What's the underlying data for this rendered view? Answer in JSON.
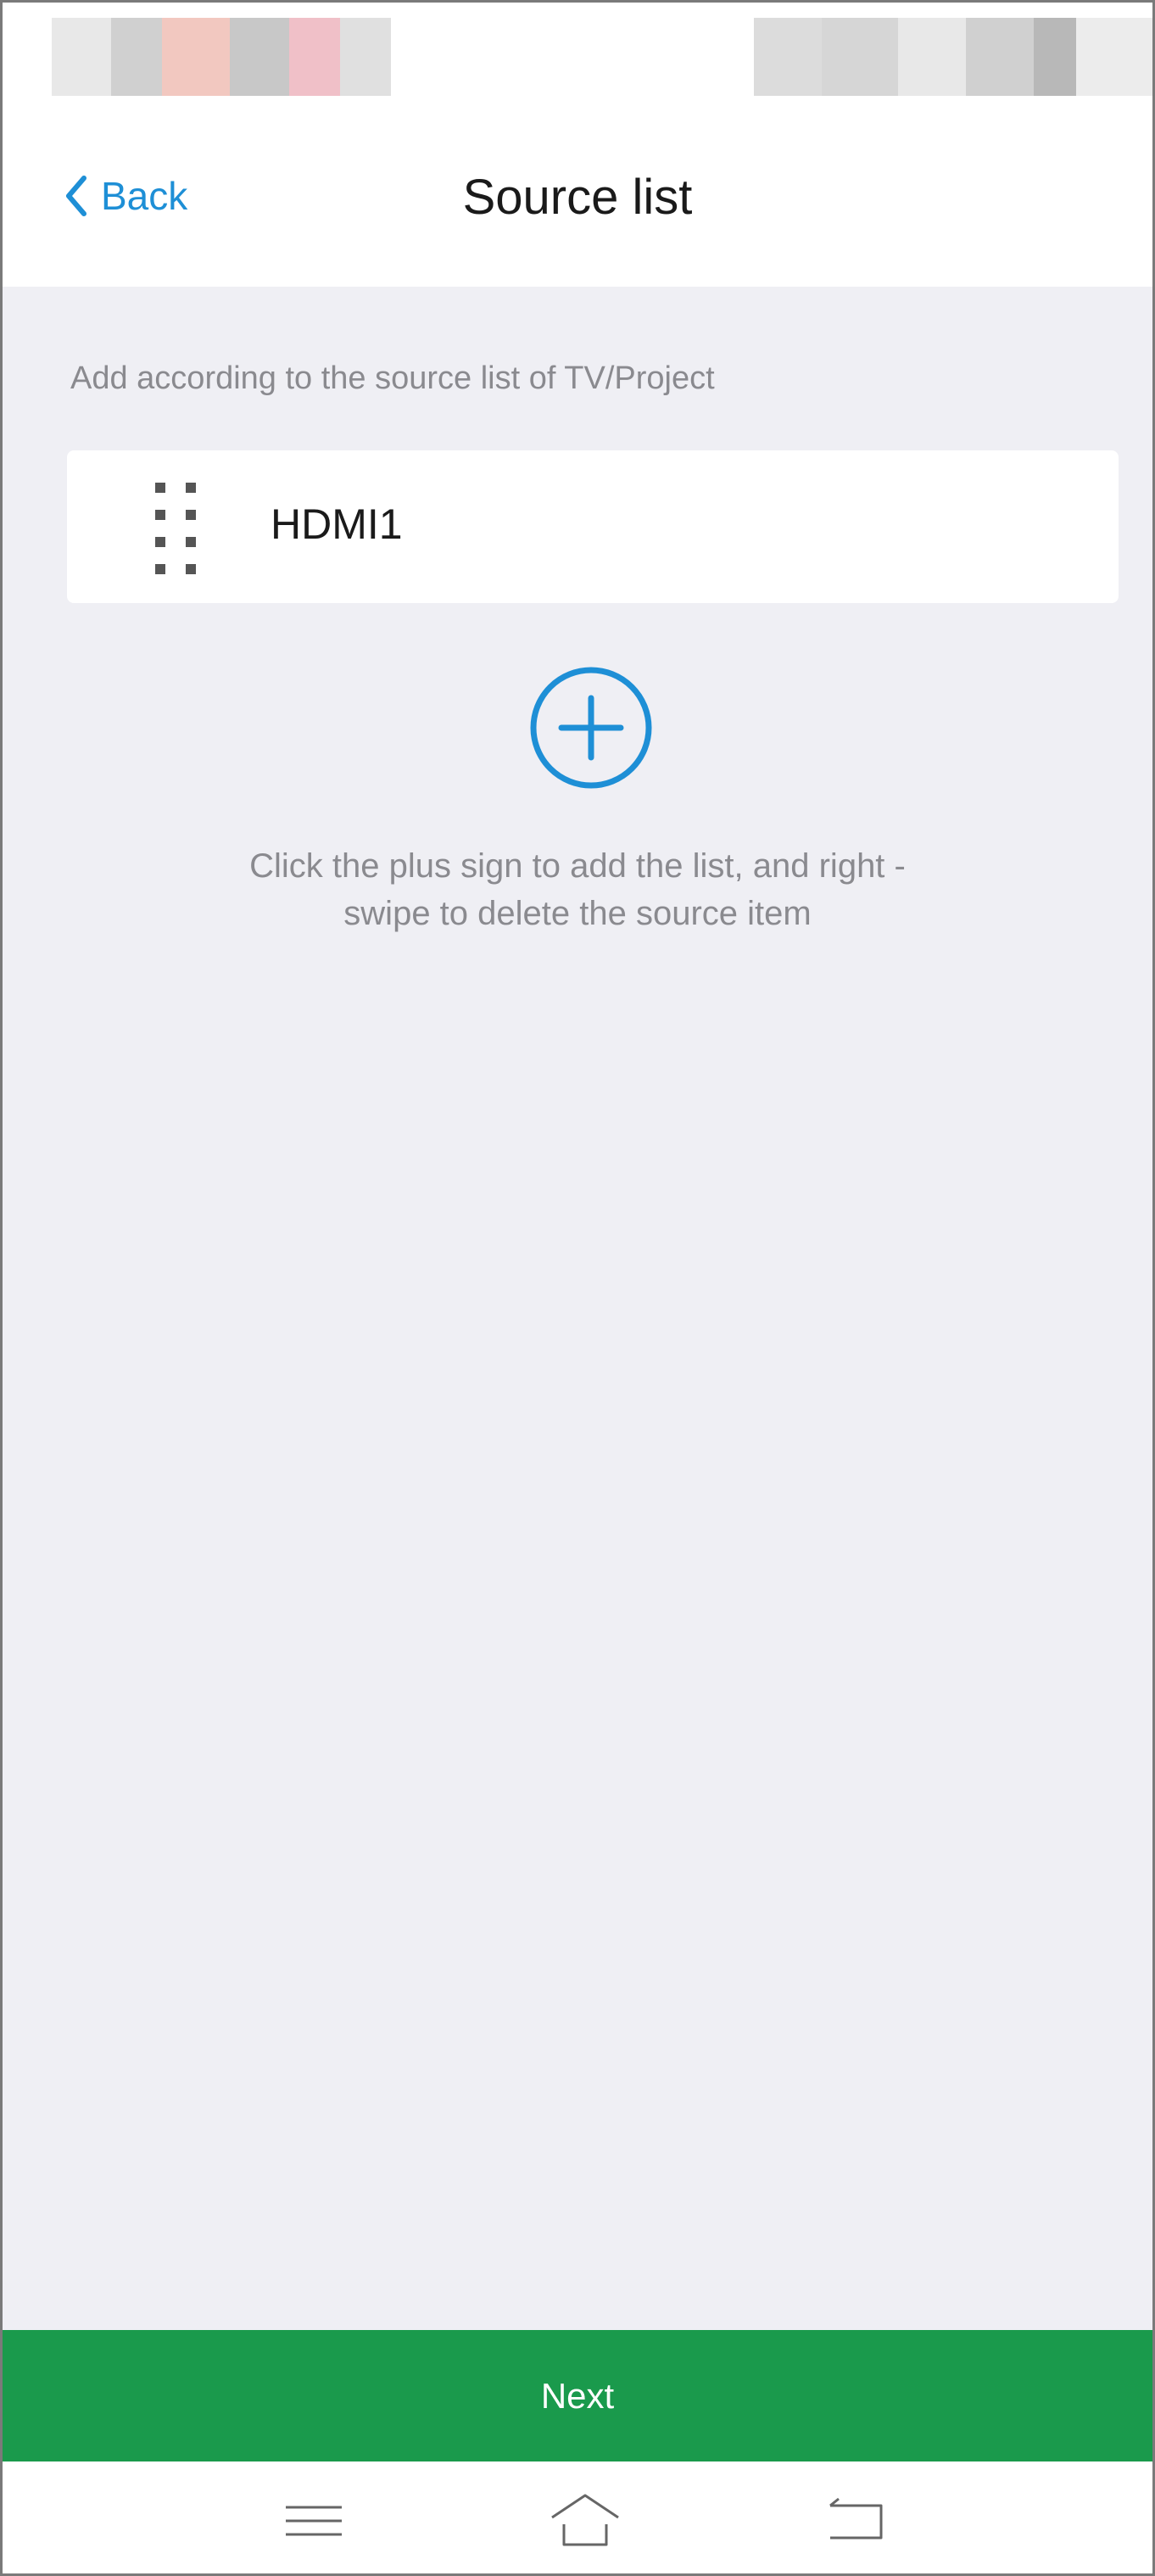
{
  "nav": {
    "back_label": "Back",
    "title": "Source list"
  },
  "content": {
    "hint_top": "Add according to the source list of TV/Project",
    "sources": [
      {
        "name": "HDMI1"
      }
    ],
    "hint_bottom_line1": "Click the plus sign to add the list, and right -",
    "hint_bottom_line2": "swipe to delete the source item"
  },
  "footer": {
    "next_label": "Next"
  },
  "colors": {
    "accent": "#1e8fd6",
    "next_button": "#1a9a4c",
    "background": "#efeff4",
    "hint_text": "#8a8a8f"
  },
  "icons": {
    "back": "chevron-left-icon",
    "drag": "drag-handle-icon",
    "add": "plus-circle-icon",
    "menu": "menu-icon",
    "home": "home-icon",
    "return": "return-icon"
  }
}
